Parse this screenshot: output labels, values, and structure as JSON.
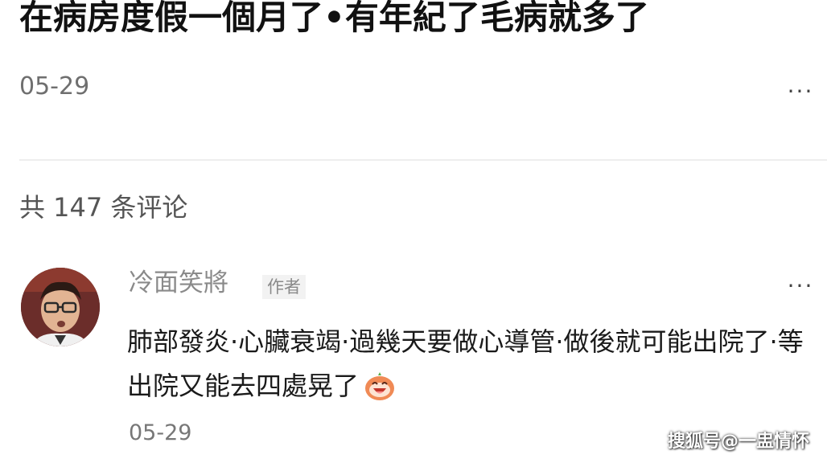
{
  "post": {
    "title": "在病房度假一個月了•有年紀了毛病就多了",
    "date": "05-29",
    "more_icon": "more-icon",
    "more_glyph": "···"
  },
  "comments_header": {
    "count_label": "共 147 条评论"
  },
  "comment": {
    "author": "冷面笑將",
    "badge": "作者",
    "text": "肺部發炎·心臟衰竭·過幾天要做心導管·做後就可能出院了·等出院又能去四處晃了",
    "emoji_icon": "laughing-emoji-icon",
    "date": "05-29",
    "more_glyph": "···"
  },
  "watermark": {
    "text": "搜狐号@一盅情怀"
  }
}
